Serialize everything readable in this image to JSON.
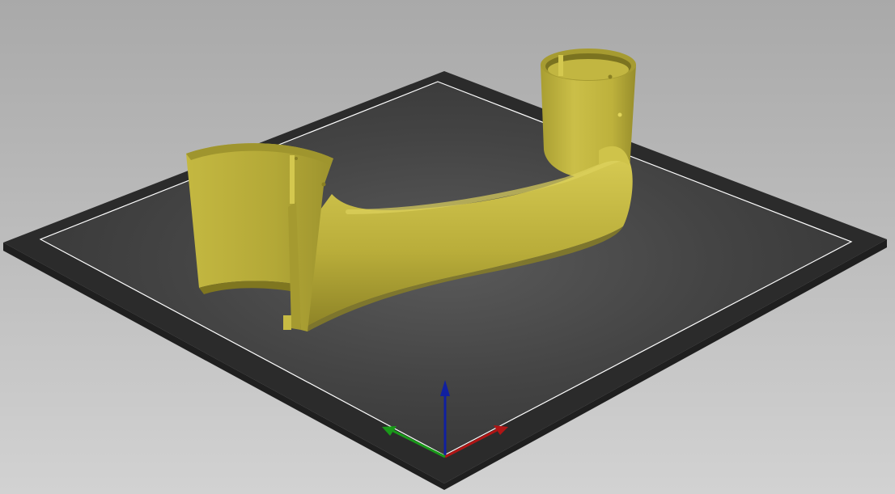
{
  "viewport": {
    "background_top": "#a9a9a9",
    "background_bottom": "#d2d2d2"
  },
  "bed": {
    "frame_color": "#2b2b2b",
    "surface_color": "#3e3e3e",
    "outline_color": "#ffffff"
  },
  "model": {
    "color": "#bdb13c",
    "shade_color": "#8f8527",
    "highlight_color": "#d8cc55"
  },
  "axes": {
    "x_color": "#b01515",
    "y_color": "#1a9a1a",
    "z_color": "#1020a0"
  }
}
